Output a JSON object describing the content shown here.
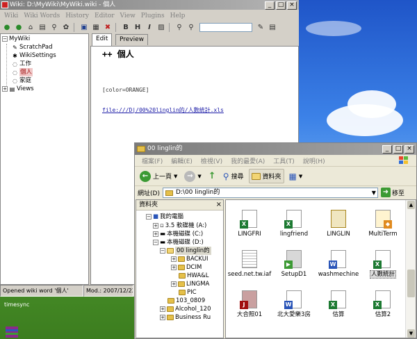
{
  "wiki": {
    "title": "Wiki: D:\\MyWiki\\MyWiki.wiki - 個人",
    "menus": [
      "Wiki",
      "Wiki Words",
      "History",
      "Editor",
      "View",
      "Plugins",
      "Help"
    ],
    "toolbar_bold": "B",
    "toolbar_italic": "I",
    "toolbar_heading": "H",
    "tree": [
      {
        "label": "MyWiki"
      },
      {
        "label": "ScratchPad"
      },
      {
        "label": "WikiSettings"
      },
      {
        "label": "工作"
      },
      {
        "label": "個人"
      },
      {
        "label": "家庭"
      },
      {
        "label": "Views"
      }
    ],
    "tabs": [
      "Edit",
      "Preview"
    ],
    "editor": {
      "heading": "++ 個人",
      "tag": "[color=ORANGE]",
      "link": "file:///D|/00%20linglin的/人數統計.xls"
    },
    "status": {
      "message": "Opened wiki word '個人'",
      "modified": "Mod.: 2007/12/22"
    }
  },
  "desktop": {
    "label": "timesync"
  },
  "explorer": {
    "title": "00 linglin的",
    "menus": [
      "檔案(F)",
      "編輯(E)",
      "檢視(V)",
      "我的最愛(A)",
      "工具(T)",
      "說明(H)"
    ],
    "back_label": "上一頁",
    "search_label": "搜尋",
    "folders_label": "資料夾",
    "address_label": "網址(D)",
    "address_value": "D:\\00 linglin的",
    "go_label": "移至",
    "folder_pane_title": "資料夾",
    "tree": [
      {
        "label": "我的電腦"
      },
      {
        "label": "3.5 軟碟機 (A:)"
      },
      {
        "label": "本機磁碟 (C:)"
      },
      {
        "label": "本機磁碟 (D:)"
      },
      {
        "label": "00 linglin的"
      },
      {
        "label": "BACKUI"
      },
      {
        "label": "DCIM"
      },
      {
        "label": "HWA&L"
      },
      {
        "label": "LINGMA"
      },
      {
        "label": "PIC"
      },
      {
        "label": "103_0809"
      },
      {
        "label": "Alcohol_120"
      },
      {
        "label": "Business Ru"
      }
    ],
    "files": [
      {
        "name": "LINGFRI",
        "kind": "excel"
      },
      {
        "name": "lingfriend",
        "kind": "excel"
      },
      {
        "name": "LINGLIN",
        "kind": "book"
      },
      {
        "name": "MultiTerm",
        "kind": "app"
      },
      {
        "name": "seed.net.tw.iaf",
        "kind": "text"
      },
      {
        "name": "SetupD1",
        "kind": "setup"
      },
      {
        "name": "washmechine",
        "kind": "word"
      },
      {
        "name": "人數統計",
        "kind": "excel"
      },
      {
        "name": "大合照01",
        "kind": "image"
      },
      {
        "name": "北大愛樂3房",
        "kind": "word"
      },
      {
        "name": "估算",
        "kind": "excel"
      },
      {
        "name": "估算2",
        "kind": "excel"
      }
    ]
  },
  "colors": {
    "excel_green": "#1d7a32",
    "word_blue": "#2a55b8",
    "link_blue": "#1a1aa6",
    "highlight_red": "#a01010"
  }
}
